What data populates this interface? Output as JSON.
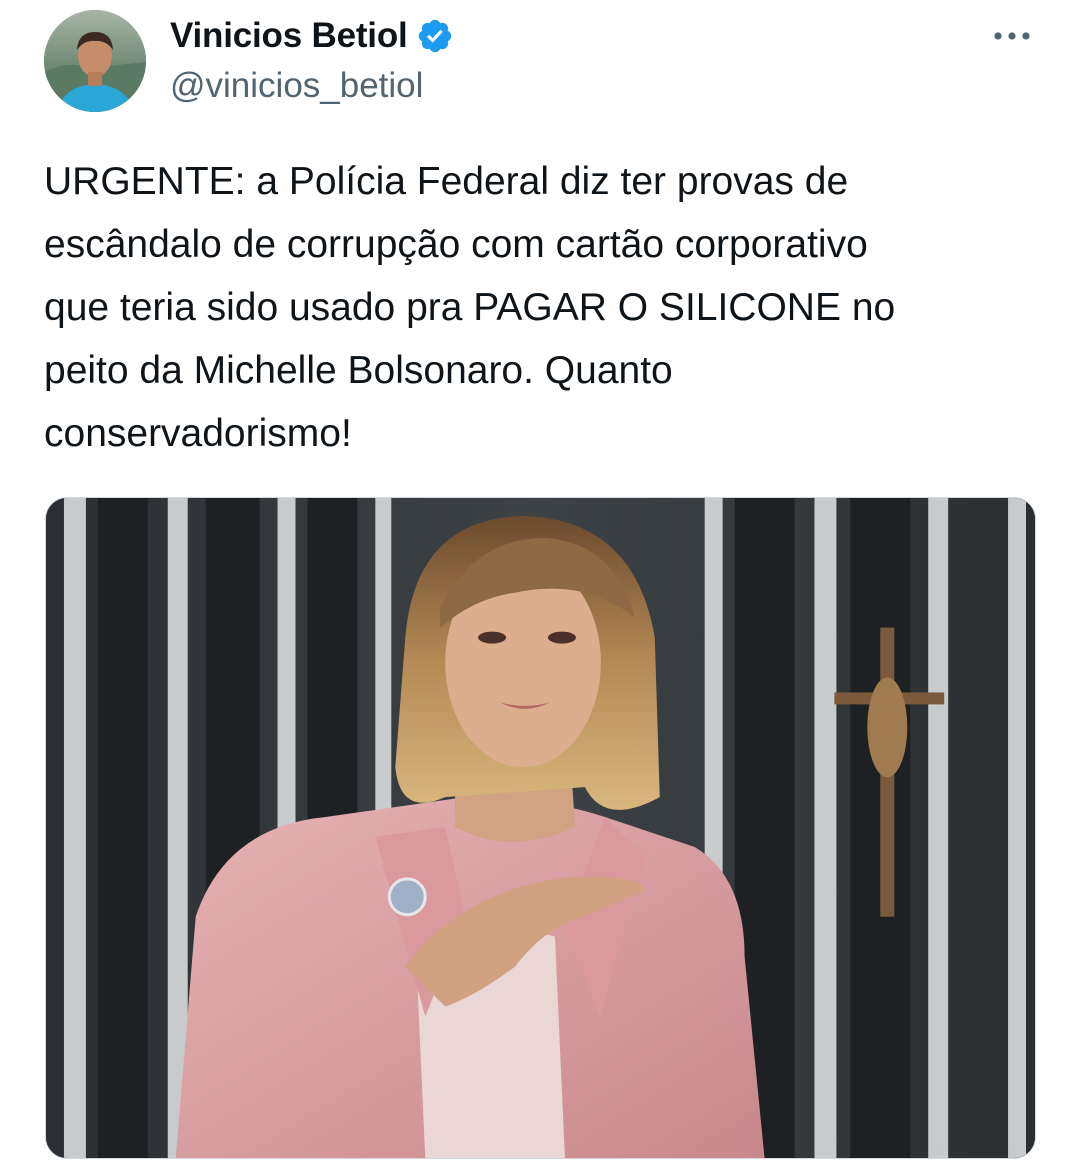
{
  "tweet": {
    "author": {
      "display_name": "Vinicios Betiol",
      "handle": "@vinicios_betiol",
      "verified": true,
      "verified_icon": "verified-badge-icon",
      "avatar_icon": "avatar-photo"
    },
    "more_icon": "more-options-icon",
    "text": "URGENTE: a Polícia Federal diz ter provas de\nescândalo de corrupção com cartão corporativo\nque teria sido usado pra PAGAR O SILICONE no\npeito da Michelle Bolsonaro. Quanto\nconservadorismo!",
    "media": {
      "type": "photo",
      "icon": "attached-photo"
    }
  },
  "colors": {
    "text_primary": "#0f1419",
    "text_secondary": "#536471",
    "verified_blue": "#1d9bf0",
    "border": "#cfd9de"
  }
}
